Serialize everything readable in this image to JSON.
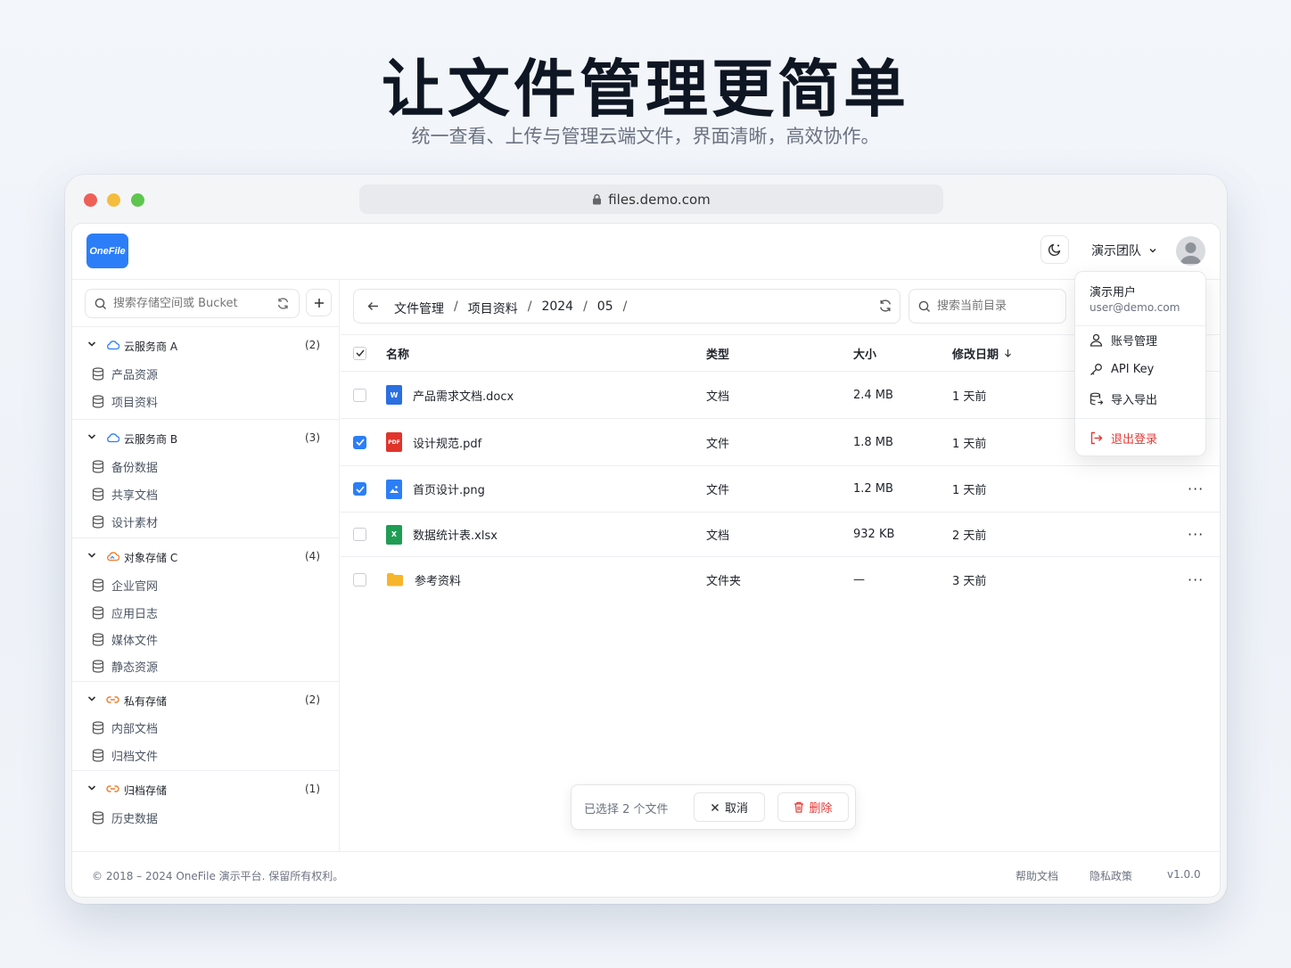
{
  "hero": {
    "title": "让文件管理更简单",
    "subtitle": "统一查看、上传与管理云端文件，界面清晰，高效协作。"
  },
  "browser": {
    "url": "files.demo.com"
  },
  "header": {
    "logo": "OneFile",
    "team": "演示团队"
  },
  "user_menu": {
    "name": "演示用户",
    "email": "user@demo.com",
    "items": [
      "账号管理",
      "API Key",
      "导入导出"
    ],
    "logout": "退出登录"
  },
  "sidebar": {
    "search_placeholder": "搜索存储空间或 Bucket",
    "providers": [
      {
        "name": "云服务商 A",
        "count": "(2)",
        "buckets": [
          "产品资源",
          "项目资料"
        ]
      },
      {
        "name": "云服务商 B",
        "count": "(3)",
        "buckets": [
          "备份数据",
          "共享文档",
          "设计素材"
        ]
      },
      {
        "name": "对象存储 C",
        "count": "(4)",
        "buckets": [
          "企业官网",
          "应用日志",
          "媒体文件",
          "静态资源"
        ]
      },
      {
        "name": "私有存储",
        "count": "(2)",
        "buckets": [
          "内部文档",
          "归档文件"
        ]
      },
      {
        "name": "归档存储",
        "count": "(1)",
        "buckets": [
          "历史数据"
        ]
      }
    ]
  },
  "breadcrumb": [
    "文件管理",
    "项目资料",
    "2024",
    "05"
  ],
  "breadcrumb_sep": "/",
  "dir_search_placeholder": "搜索当前目录",
  "table": {
    "columns": {
      "name": "名称",
      "type": "类型",
      "size": "大小",
      "modified": "修改日期"
    },
    "rows": [
      {
        "name": "产品需求文档.docx",
        "type": "文档",
        "size": "2.4 MB",
        "modified": "1 天前",
        "icon": "word-icon",
        "selected": false
      },
      {
        "name": "设计规范.pdf",
        "type": "文件",
        "size": "1.8 MB",
        "modified": "1 天前",
        "icon": "pdf-icon",
        "selected": true
      },
      {
        "name": "首页设计.png",
        "type": "文件",
        "size": "1.2 MB",
        "modified": "1 天前",
        "icon": "image-icon",
        "selected": true
      },
      {
        "name": "数据统计表.xlsx",
        "type": "文档",
        "size": "932 KB",
        "modified": "2 天前",
        "icon": "excel-icon",
        "selected": false
      },
      {
        "name": "参考资料",
        "type": "文件夹",
        "size": "—",
        "modified": "3 天前",
        "icon": "folder-icon",
        "selected": false
      }
    ]
  },
  "selection": {
    "text": "已选择 2 个文件",
    "cancel": "取消",
    "delete": "删除"
  },
  "footer": {
    "copyright": "© 2018 – 2024 OneFile 演示平台. 保留所有权利。",
    "help": "帮助文档",
    "privacy": "隐私政策",
    "version": "v1.0.0"
  },
  "colors": {
    "accent": "#2c7ef8",
    "danger": "#e53935",
    "word": "#2b6fe0",
    "pdf": "#e0342b",
    "image": "#2c7ef8",
    "excel": "#1f9d55",
    "folder": "#f7b52b",
    "provider_cloud": "#2c7ef8",
    "provider_orange": "#f07a2b"
  }
}
